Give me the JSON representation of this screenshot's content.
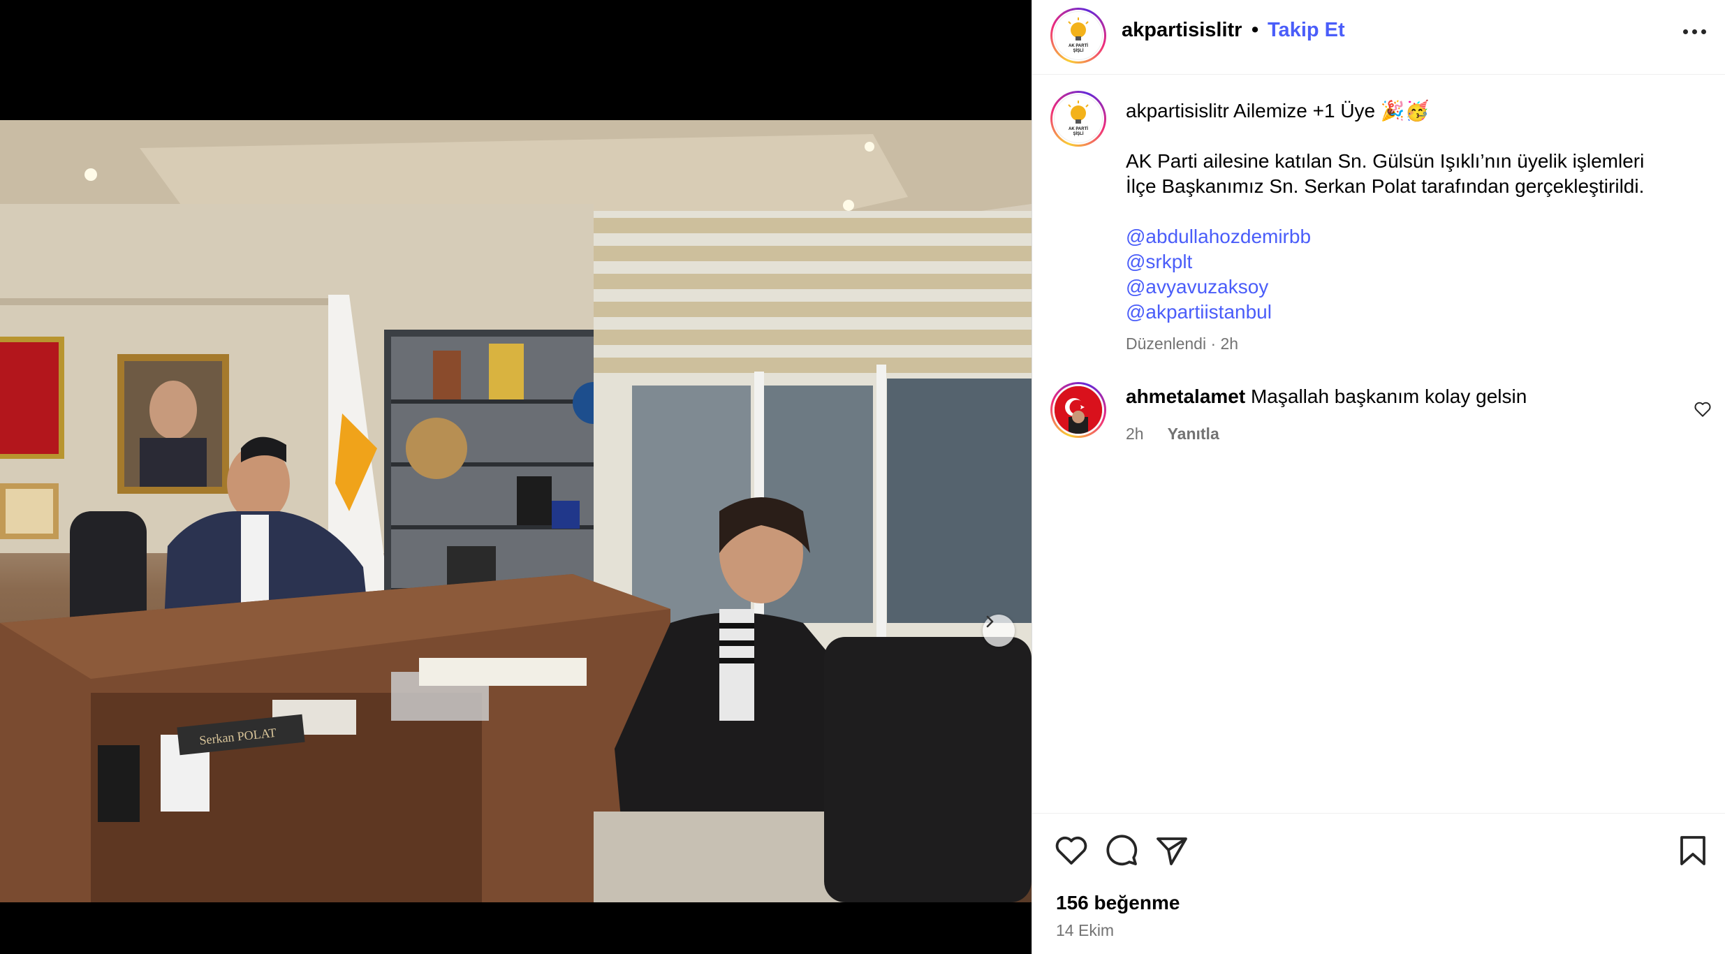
{
  "post": {
    "author": "akpartisislitr",
    "follow_label": "Takip Et",
    "separator": "•",
    "avatar_text_top": "AK PARTİ",
    "avatar_text_bottom": "ŞİŞLİ"
  },
  "caption": {
    "username": "akpartisislitr",
    "headline": "Ailemize +1 Üye 🎉🥳",
    "body_line_1": "AK Parti ailesine katılan Sn. Gülsün Işıklı’nın üyelik işlemleri",
    "body_line_2": "İlçe Başkanımız Sn. Serkan Polat tarafından gerçekleştirildi.",
    "mentions": [
      "@abdullahozdemirbb",
      "@srkplt",
      "@avyavuzaksoy",
      "@akpartiistanbul"
    ],
    "edited": "Düzenlendi · 2h"
  },
  "comments": [
    {
      "username": "ahmetalamet",
      "text": "Maşallah başkanım kolay gelsin",
      "time": "2h",
      "reply_label": "Yanıtla"
    }
  ],
  "footer": {
    "likes": "156 beğenme",
    "date": "14 Ekim"
  },
  "media": {
    "desk_nameplate": "Serkan POLAT",
    "carousel_count": 2,
    "carousel_active": 0
  },
  "icons": {
    "like": "heart-icon",
    "comment": "comment-icon",
    "share": "send-icon",
    "save": "bookmark-icon",
    "more": "more-dots-icon",
    "next": "chevron-right-icon",
    "tag": "user-tag-icon"
  },
  "colors": {
    "link": "#4a5df9",
    "muted": "#737373",
    "border": "#dbdbdb"
  }
}
